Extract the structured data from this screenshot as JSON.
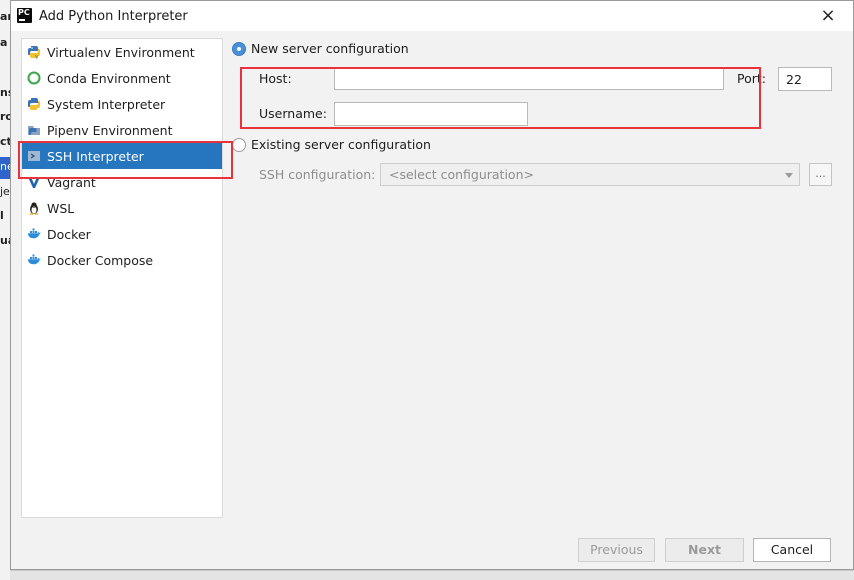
{
  "background_fragments": [
    "ar",
    "a",
    "",
    "ns",
    "ro",
    "ct",
    "ne",
    "je",
    "l",
    "ua"
  ],
  "dialog": {
    "title": "Add Python Interpreter",
    "app_icon_text": "PC",
    "close_symbol": "×"
  },
  "sidebar": {
    "items": [
      {
        "label": "Virtualenv Environment",
        "icon": "python-icon"
      },
      {
        "label": "Conda Environment",
        "icon": "conda-icon"
      },
      {
        "label": "System Interpreter",
        "icon": "python-icon"
      },
      {
        "label": "Pipenv Environment",
        "icon": "pipenv-icon"
      },
      {
        "label": "SSH Interpreter",
        "icon": "ssh-terminal-icon",
        "selected": true
      },
      {
        "label": "Vagrant",
        "icon": "vagrant-icon"
      },
      {
        "label": "WSL",
        "icon": "linux-penguin-icon"
      },
      {
        "label": "Docker",
        "icon": "docker-icon"
      },
      {
        "label": "Docker Compose",
        "icon": "docker-icon"
      }
    ]
  },
  "main": {
    "new_server": {
      "label": "New server configuration",
      "selected": true,
      "host_label": "Host:",
      "host_value": "",
      "port_label": "Port:",
      "port_value": "22",
      "username_label": "Username:",
      "username_value": ""
    },
    "existing_server": {
      "label": "Existing server configuration",
      "selected": false,
      "ssh_config_label": "SSH configuration:",
      "ssh_config_placeholder": "<select configuration>",
      "browse_label": "..."
    }
  },
  "buttons": {
    "previous": "Previous",
    "next": "Next",
    "cancel": "Cancel"
  },
  "colors": {
    "selection": "#2675bf",
    "highlight_box": "#e8333c",
    "radio_selected": "#4a90d9"
  }
}
